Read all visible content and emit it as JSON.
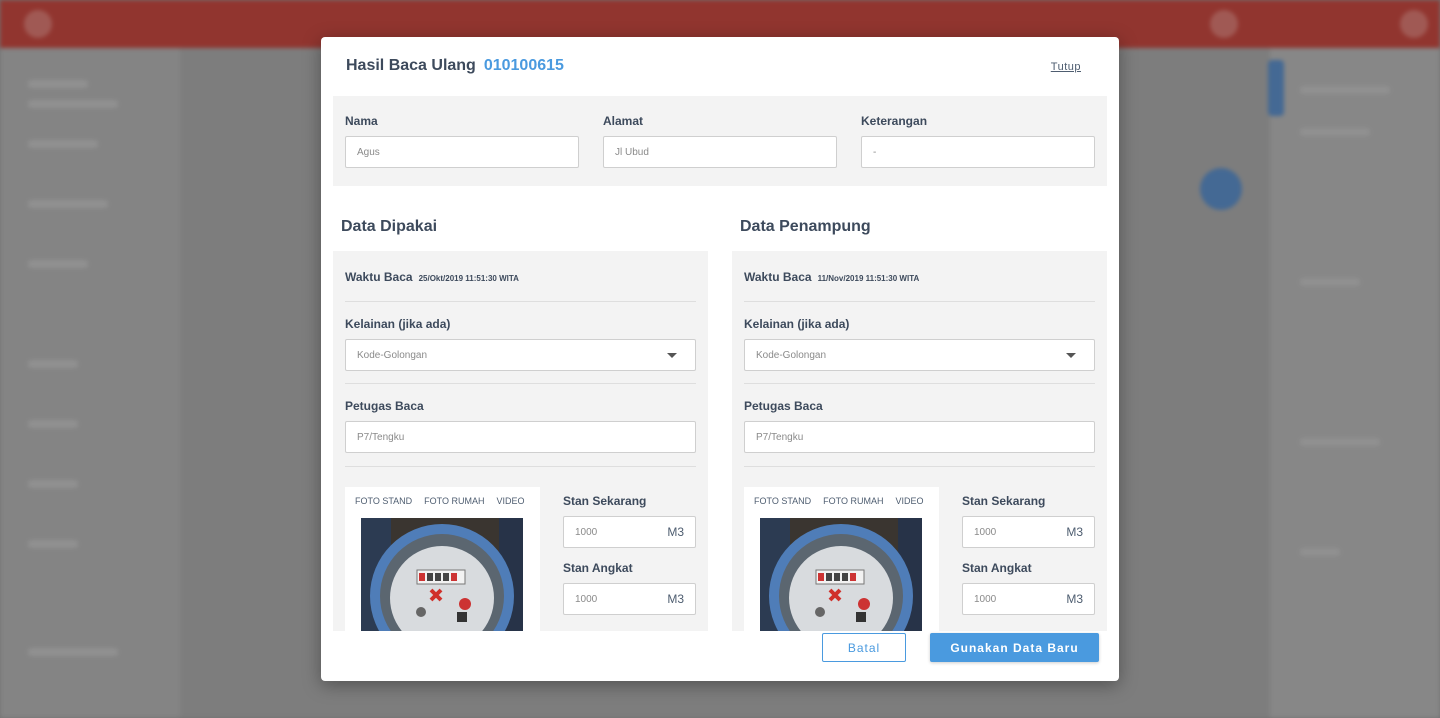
{
  "modal": {
    "title": "Hasil Baca Ulang",
    "code": "010100615",
    "close_label": "Tutup"
  },
  "customer": {
    "nama_label": "Nama",
    "nama_value": "Agus",
    "alamat_label": "Alamat",
    "alamat_value": "Jl Ubud",
    "keterangan_label": "Keterangan",
    "keterangan_value": "-"
  },
  "panels": [
    {
      "title": "Data Dipakai",
      "waktu_label": "Waktu Baca",
      "waktu_value": "25/Okt/2019 11:51:30 WITA",
      "kelainan_label": "Kelainan (jika ada)",
      "kelainan_value": "Kode-Golongan",
      "petugas_label": "Petugas Baca",
      "petugas_value": "P7/Tengku",
      "media_tabs": [
        "FOTO STAND",
        "FOTO RUMAH",
        "VIDEO"
      ],
      "stan_sekarang_label": "Stan Sekarang",
      "stan_sekarang_value": "1000",
      "stan_angkat_label": "Stan Angkat",
      "stan_angkat_value": "1000",
      "unit": "M3"
    },
    {
      "title": "Data Penampung",
      "waktu_label": "Waktu Baca",
      "waktu_value": "11/Nov/2019 11:51:30 WITA",
      "kelainan_label": "Kelainan (jika ada)",
      "kelainan_value": "Kode-Golongan",
      "petugas_label": "Petugas Baca",
      "petugas_value": "P7/Tengku",
      "media_tabs": [
        "FOTO STAND",
        "FOTO RUMAH",
        "VIDEO"
      ],
      "stan_sekarang_label": "Stan Sekarang",
      "stan_sekarang_value": "1000",
      "stan_angkat_label": "Stan Angkat",
      "stan_angkat_value": "1000",
      "unit": "M3"
    }
  ],
  "buttons": {
    "cancel": "Batal",
    "confirm": "Gunakan Data Baru"
  },
  "colors": {
    "accent": "#4a9adf",
    "topbar": "#b53a32"
  }
}
